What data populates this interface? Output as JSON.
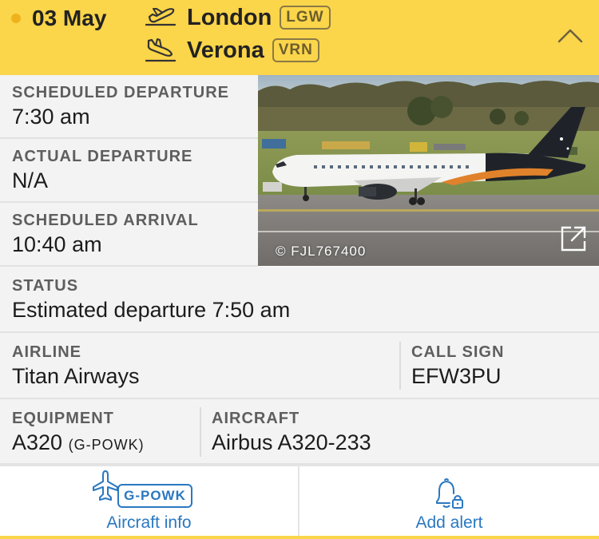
{
  "header": {
    "date": "03 May",
    "departure": {
      "city": "London",
      "code": "LGW"
    },
    "arrival": {
      "city": "Verona",
      "code": "VRN"
    },
    "accent_color": "#fbd54a",
    "icons": {
      "departure": "takeoff-icon",
      "arrival": "landing-icon",
      "collapse": "chevron-up-icon"
    }
  },
  "details": {
    "scheduled_departure": {
      "label": "SCHEDULED DEPARTURE",
      "value": "7:30 am"
    },
    "actual_departure": {
      "label": "ACTUAL DEPARTURE",
      "value": "N/A"
    },
    "scheduled_arrival": {
      "label": "SCHEDULED ARRIVAL",
      "value": "10:40 am"
    },
    "status": {
      "label": "STATUS",
      "value": "Estimated departure 7:50 am"
    },
    "airline": {
      "label": "AIRLINE",
      "value": "Titan Airways"
    },
    "call_sign": {
      "label": "CALL SIGN",
      "value": "EFW3PU"
    },
    "equipment": {
      "label": "EQUIPMENT",
      "value": "A320",
      "registration": "(G-POWK)"
    },
    "aircraft": {
      "label": "AIRCRAFT",
      "value": "Airbus A320-233"
    }
  },
  "photo": {
    "credit": "© FJL767400",
    "icon": "external-link-icon"
  },
  "actions": {
    "aircraft_info": {
      "badge": "G-POWK",
      "label": "Aircraft info",
      "icon": "plane-icon"
    },
    "add_alert": {
      "label": "Add alert",
      "icon": "bell-lock-icon"
    },
    "link_color": "#2a78c1"
  }
}
